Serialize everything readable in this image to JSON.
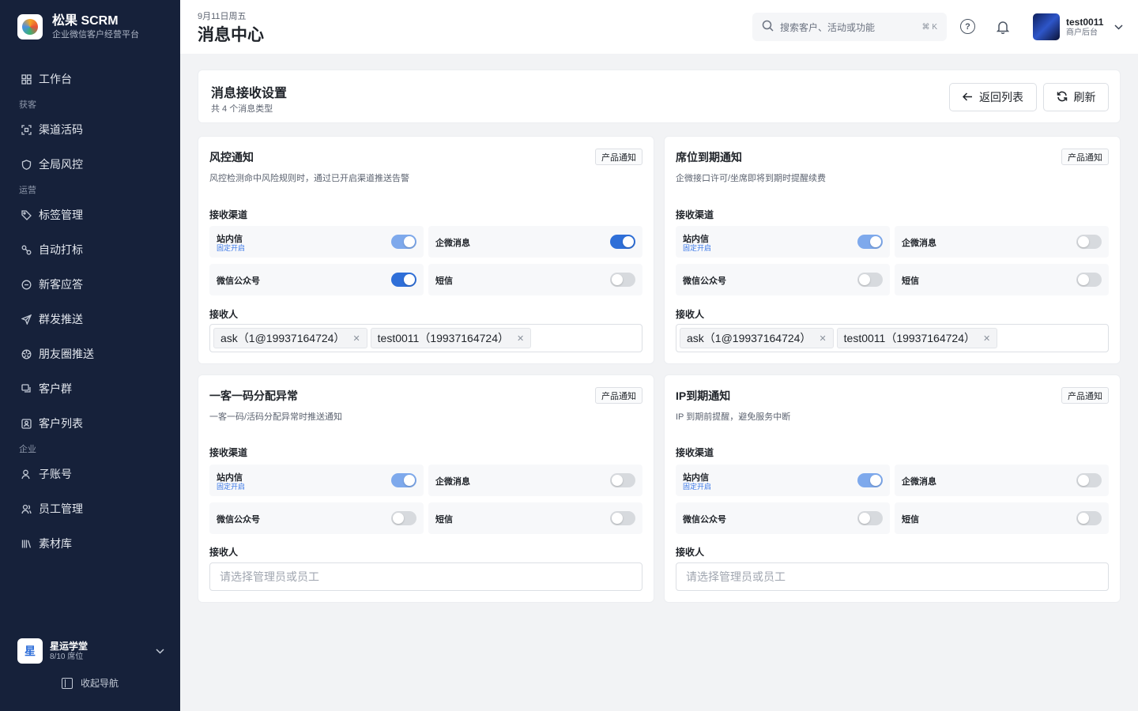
{
  "brand": {
    "name": "松果 SCRM",
    "subtitle": "企业微信客户经营平台"
  },
  "nav": {
    "workbench": "工作台",
    "group_acquire": "获客",
    "channel_code": "渠道活码",
    "risk_control": "全局风控",
    "group_operate": "运营",
    "tag_mgmt": "标签管理",
    "auto_tag": "自动打标",
    "new_reply": "新客应答",
    "group_send": "群发推送",
    "moments": "朋友圈推送",
    "customer_group": "客户群",
    "customer_list": "客户列表",
    "group_enterprise": "企业",
    "sub_account": "子账号",
    "staff": "员工管理",
    "materials": "素材库"
  },
  "org": {
    "logo_char": "星",
    "name": "星运学堂",
    "seats": "8/10 席位"
  },
  "collapse_label": "收起导航",
  "header": {
    "date": "9月11日周五",
    "title": "消息中心",
    "search_placeholder": "搜索客户、活动或功能",
    "search_shortcut": "⌘ K",
    "user_name": "test0011",
    "user_role": "商户后台"
  },
  "settings": {
    "title": "消息接收设置",
    "count": "共 4 个消息类型",
    "back_label": "返回列表",
    "refresh_label": "刷新"
  },
  "labels": {
    "channels": "接收渠道",
    "receivers": "接收人",
    "fixed_on": "固定开启",
    "ch_site": "站内信",
    "ch_wecom": "企微消息",
    "ch_mp": "微信公众号",
    "ch_sms": "短信",
    "receiver_placeholder": "请选择管理员或员工"
  },
  "cards": [
    {
      "title": "风控通知",
      "badge": "产品通知",
      "desc": "风控检测命中风险规则时，通过已开启渠道推送告警",
      "toggles": {
        "site": true,
        "wecom": true,
        "mp": true,
        "sms": false
      },
      "receivers": [
        "ask（1@19937164724）",
        "test0011（19937164724）"
      ]
    },
    {
      "title": "席位到期通知",
      "badge": "产品通知",
      "desc": "企微接口许可/坐席即将到期时提醒续费",
      "toggles": {
        "site": true,
        "wecom": false,
        "mp": false,
        "sms": false
      },
      "receivers": [
        "ask（1@19937164724）",
        "test0011（19937164724）"
      ]
    },
    {
      "title": "一客一码分配异常",
      "badge": "产品通知",
      "desc": "一客一码/活码分配异常时推送通知",
      "toggles": {
        "site": true,
        "wecom": false,
        "mp": false,
        "sms": false
      },
      "receivers": []
    },
    {
      "title": "IP到期通知",
      "badge": "产品通知",
      "desc": "IP 到期前提醒，避免服务中断",
      "toggles": {
        "site": true,
        "wecom": false,
        "mp": false,
        "sms": false
      },
      "receivers": []
    }
  ]
}
